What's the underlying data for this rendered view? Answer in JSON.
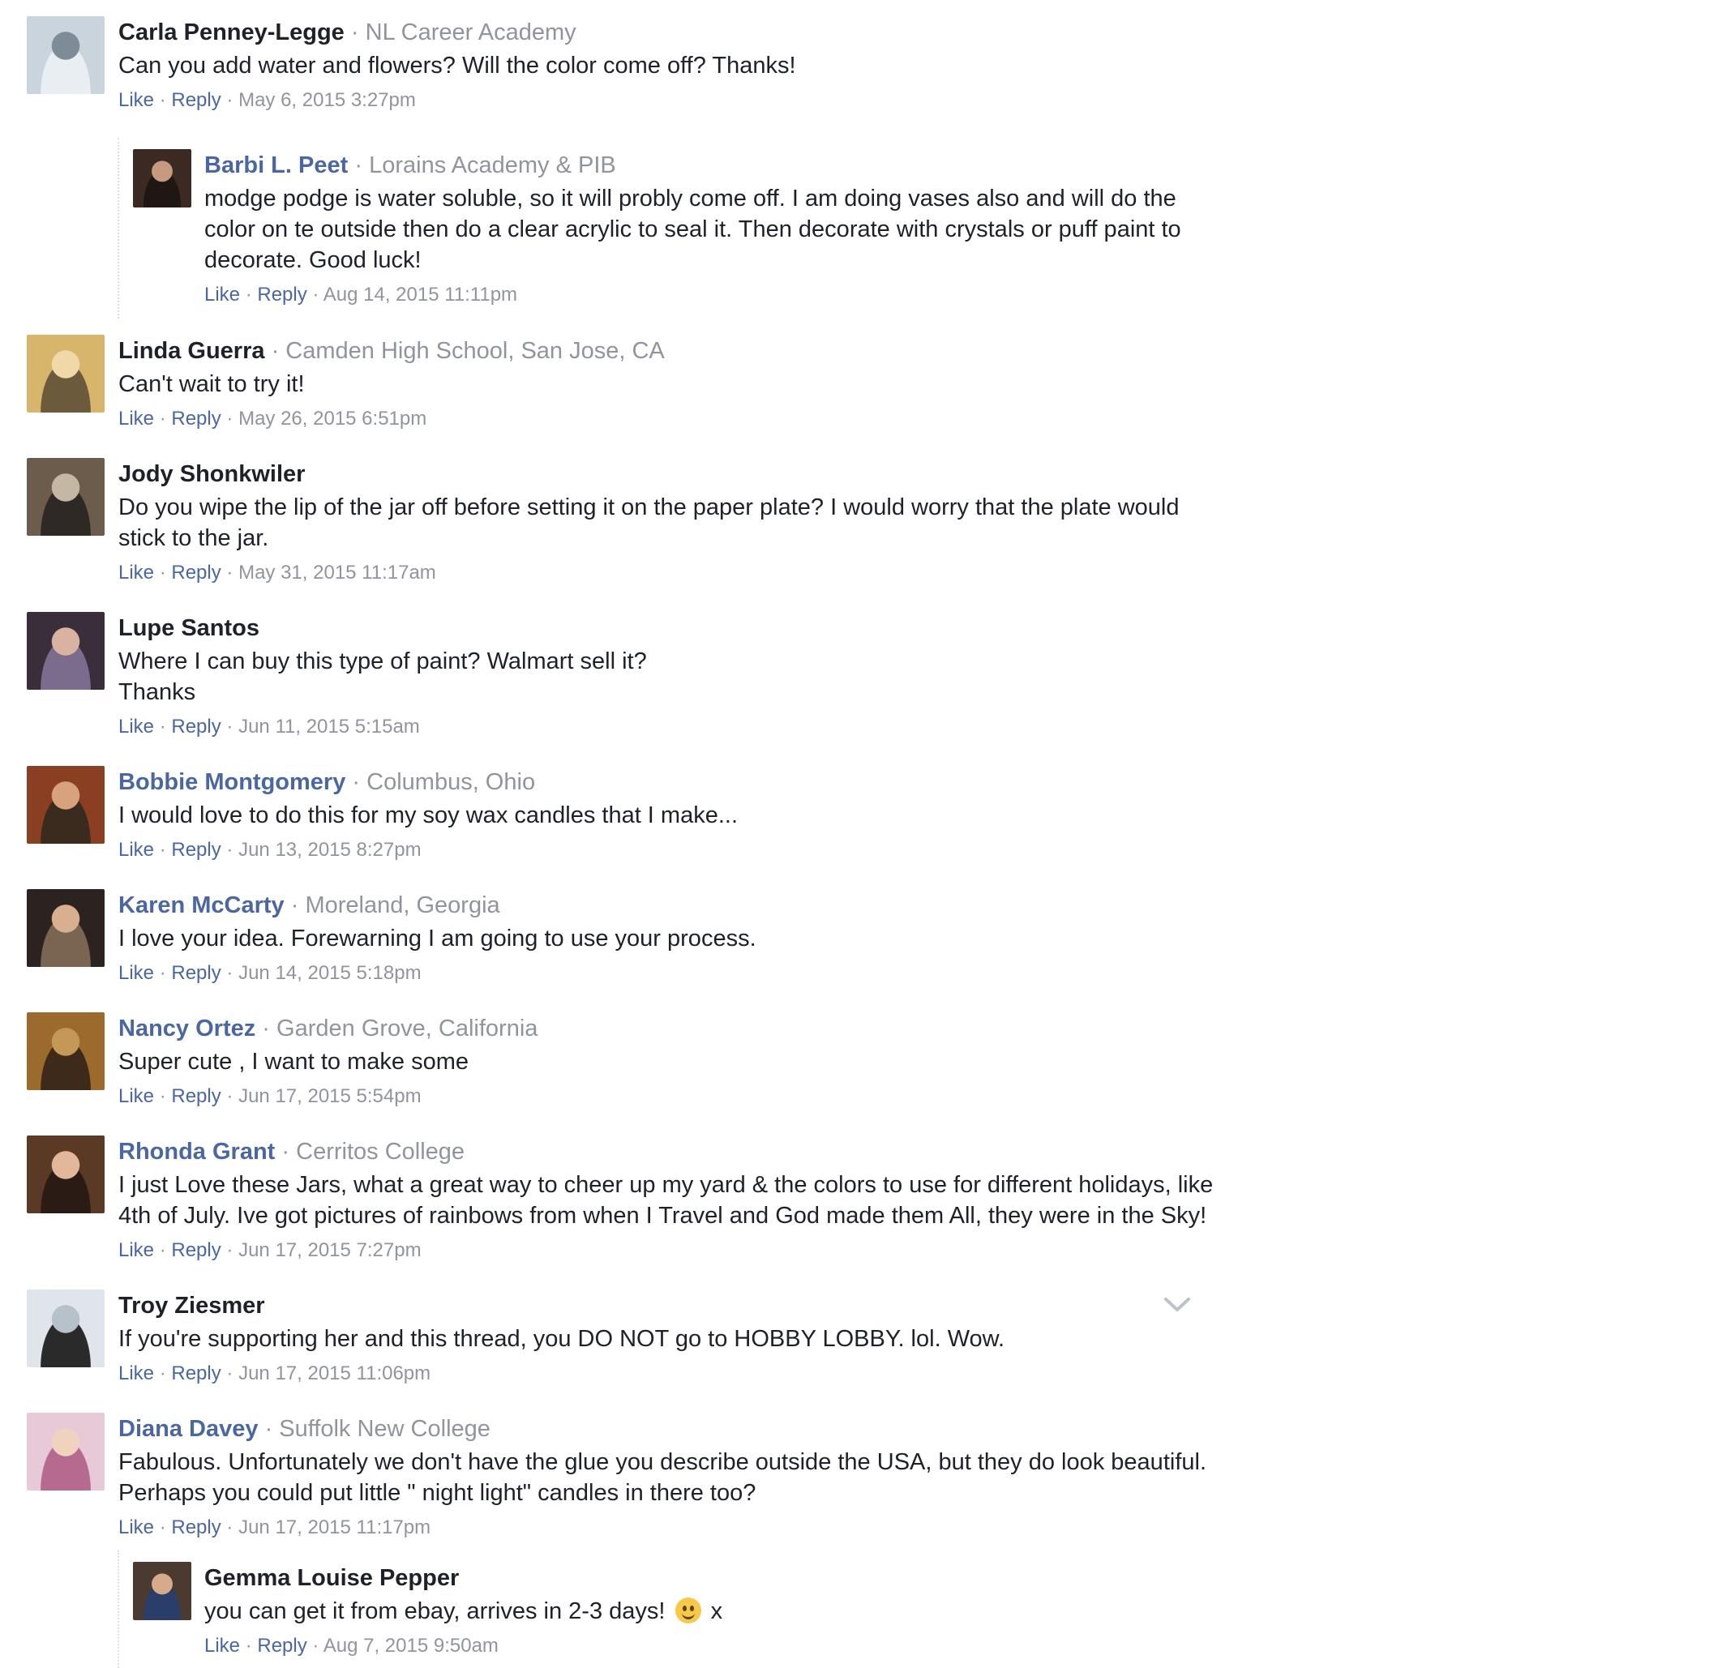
{
  "actions": {
    "like": "Like",
    "reply": "Reply",
    "separator": "·"
  },
  "comments": [
    {
      "name": "Carla Penney-Legge",
      "linked": false,
      "sub": "NL Career Academy",
      "text": "Can you add water and flowers? Will the color come off? Thanks!",
      "time": "May 6, 2015 3:27pm",
      "avatar": "winter-portrait"
    },
    {
      "name": "Barbi L. Peet",
      "linked": true,
      "sub": "Lorains Academy & PIB",
      "text": "modge podge is water soluble, so it will probly come off. I am doing vases also and will do the color on te outside then do a clear acrylic to seal it. Then decorate with crystals or puff paint to decorate. Good luck!",
      "time": "Aug 14, 2015 11:11pm",
      "reply": true,
      "avatar": "dark-hair-portrait"
    },
    {
      "name": "Linda Guerra",
      "linked": false,
      "sub": "Camden High School, San Jose, CA",
      "text": "Can't wait to try it!",
      "time": "May 26, 2015 6:51pm",
      "avatar": "blonde-portrait"
    },
    {
      "name": "Jody Shonkwiler",
      "linked": false,
      "sub": "",
      "text": "Do you wipe the lip of the jar off before setting it on the paper plate? I would worry that the plate would stick to the jar.",
      "time": "May 31, 2015 11:17am",
      "avatar": "couple-photo"
    },
    {
      "name": "Lupe Santos",
      "linked": false,
      "sub": "",
      "text": "Where I can buy this type of paint? Walmart sell it?\nThanks",
      "time": "Jun 11, 2015 5:15am",
      "avatar": "selfie"
    },
    {
      "name": "Bobbie Montgomery",
      "linked": true,
      "sub": "Columbus, Ohio",
      "text": "I would love to do this for my soy wax candles that I make...",
      "time": "Jun 13, 2015 8:27pm",
      "avatar": "redhead-portrait"
    },
    {
      "name": "Karen McCarty",
      "linked": true,
      "sub": "Moreland, Georgia",
      "text": "I love your idea. Forewarning I am going to use your process.",
      "time": "Jun 14, 2015 5:18pm",
      "avatar": "couple-portrait"
    },
    {
      "name": "Nancy Ortez",
      "linked": true,
      "sub": "Garden Grove, California",
      "text": "Super cute , I want to make some",
      "time": "Jun 17, 2015 5:54pm",
      "avatar": "artistic-portrait"
    },
    {
      "name": "Rhonda Grant",
      "linked": true,
      "sub": "Cerritos College",
      "text": "I just Love these Jars, what a great way to cheer up my yard & the colors to use for different holidays, like 4th of July. Ive got pictures of rainbows from when I Travel and God made them All, they were in the Sky!",
      "time": "Jun 17, 2015 7:27pm",
      "avatar": "smiling-portrait"
    },
    {
      "name": "Troy Ziesmer",
      "linked": false,
      "sub": "",
      "text": "If you're supporting her and this thread, you DO NOT go to HOBBY LOBBY. lol. Wow.",
      "time": "Jun 17, 2015 11:06pm",
      "avatar": "snow-dog-photo"
    },
    {
      "name": "Diana Davey",
      "linked": true,
      "sub": "Suffolk New College",
      "text": "Fabulous. Unfortunately we don't have the glue you describe outside the USA, but they do look beautiful. Perhaps you could put little \" night light\" candles in there too?",
      "time": "Jun 17, 2015 11:17pm",
      "avatar": "baby-photo"
    },
    {
      "name": "Gemma Louise Pepper",
      "linked": false,
      "sub": "",
      "text": "you can get it from ebay, arrives in 2-3 days!",
      "text_suffix": "x",
      "emoji": "smile-emoji",
      "time": "Aug 7, 2015 9:50am",
      "reply": true,
      "avatar": "friends-selfie"
    }
  ],
  "avatar_colors": {
    "winter-portrait": [
      "#c9d4dc",
      "#7d8c96",
      "#e8eef2"
    ],
    "dark-hair-portrait": [
      "#3b2a22",
      "#c79a80",
      "#1f1713"
    ],
    "blonde-portrait": [
      "#d7b56b",
      "#f1d8a8",
      "#6b5a3c"
    ],
    "couple-photo": [
      "#6b5c4c",
      "#c4b7a3",
      "#2e2924"
    ],
    "selfie": [
      "#3a2e3b",
      "#d9b2a2",
      "#7b6c8e"
    ],
    "redhead-portrait": [
      "#8b3f22",
      "#d9a27e",
      "#3b2a1e"
    ],
    "couple-portrait": [
      "#2c2320",
      "#d8b08f",
      "#7a6552"
    ],
    "artistic-portrait": [
      "#9c6a2d",
      "#c49856",
      "#3d2a1a"
    ],
    "smiling-portrait": [
      "#5a3a24",
      "#e2b79a",
      "#2a1c14"
    ],
    "snow-dog-photo": [
      "#dfe5ea",
      "#b6c1c9",
      "#2a2a2a"
    ],
    "baby-photo": [
      "#e8c9d7",
      "#f0d3bf",
      "#b66a8f"
    ],
    "friends-selfie": [
      "#4a3a30",
      "#d6ab8c",
      "#2a3e6a"
    ]
  },
  "chevron": "chevron-down-icon"
}
